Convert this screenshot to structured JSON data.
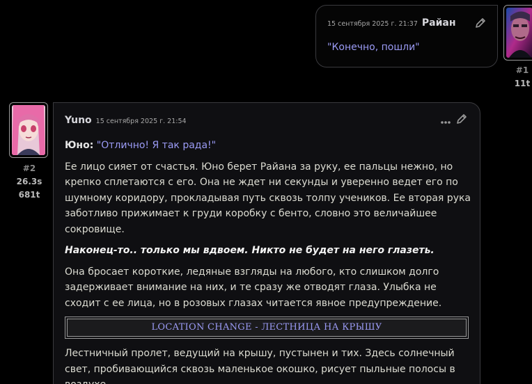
{
  "user_message": {
    "timestamp": "15 сентября 2025 г. 21:37",
    "author": "Райан",
    "text": "\"Конечно, пошли\"",
    "index": "#1",
    "tokens": "11t"
  },
  "bot_message": {
    "author": "Yuno",
    "timestamp": "15 сентября 2025 г. 21:54",
    "index": "#2",
    "time": "26.3s",
    "tokens": "681t",
    "speaker": "Юно:",
    "quote": "\"Отлично! Я так рада!\"",
    "paragraph_1": "Ее лицо сияет от счастья. Юно берет Райана за руку, ее пальцы нежно, но крепко сплетаются с его. Она не ждет ни секунды и уверенно ведет его по шумному коридору, прокладывая путь сквозь толпу учеников. Ее вторая рука заботливо прижимает к груди коробку с бенто, словно это величайшее сокровище.",
    "thought": "Наконец-то.. только мы вдвоем. Никто не будет на него глазеть.",
    "paragraph_2": "Она бросает короткие, ледяные взгляды на любого, кто слишком долго задерживает внимание на них, и те сразу же отводят глаза. Улыбка не сходит с ее лица, но в розовых глазах читается явное предупреждение.",
    "location_change": "LOCATION CHANGE - ЛЕСТНИЦА НА КРЫШУ",
    "paragraph_3": "Лестничный пролет, ведущий на крышу, пустынен и тих. Здесь солнечный свет, пробивающийся сквозь маленькое окошко, рисует пыльные полосы в воздухе."
  },
  "icons": {
    "edit": "pencil-icon",
    "more": "ellipsis-icon"
  },
  "colors": {
    "background": "#000000",
    "bubble": "#0f0f12",
    "quote": "#9b9bf5",
    "text": "#dcdcd2"
  }
}
